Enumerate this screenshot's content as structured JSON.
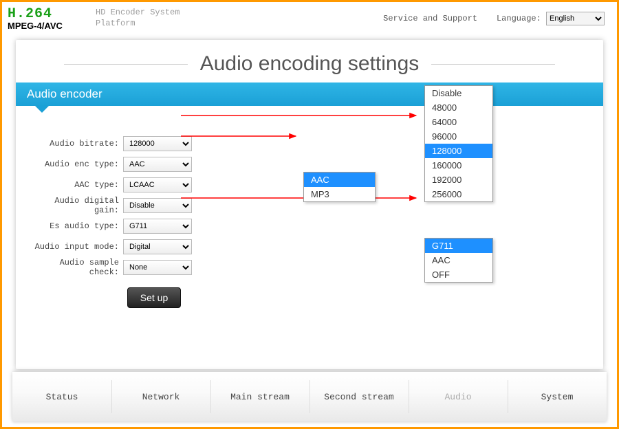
{
  "logo": {
    "line1": "H.264",
    "line2": "MPEG-4/AVC"
  },
  "platform": {
    "line1": "HD Encoder System",
    "line2": "Platform"
  },
  "top": {
    "service": "Service and Support",
    "language_label": "Language:",
    "language_value": "English"
  },
  "page_title": "Audio encoding settings",
  "section_title": "Audio encoder",
  "form": {
    "audio_bitrate": {
      "label": "Audio bitrate:",
      "value": "128000"
    },
    "audio_enc_type": {
      "label": "Audio enc type:",
      "value": "AAC"
    },
    "aac_type": {
      "label": "AAC type:",
      "value": "LCAAC"
    },
    "audio_digital_gain": {
      "label": "Audio digital gain:",
      "value": "Disable"
    },
    "es_audio_type": {
      "label": "Es audio type:",
      "value": "G711"
    },
    "audio_input_mode": {
      "label": "Audio input mode:",
      "value": "Digital"
    },
    "audio_sample_check": {
      "label": "Audio sample check:",
      "value": "None"
    }
  },
  "setup_button": "Set up",
  "dropdowns": {
    "bitrate_options": [
      "Disable",
      "48000",
      "64000",
      "96000",
      "128000",
      "160000",
      "192000",
      "256000"
    ],
    "bitrate_selected": "128000",
    "enc_options": [
      "AAC",
      "MP3"
    ],
    "enc_selected": "AAC",
    "es_options": [
      "G711",
      "AAC",
      "OFF"
    ],
    "es_selected": "G711"
  },
  "tabs": [
    "Status",
    "Network",
    "Main stream",
    "Second stream",
    "Audio",
    "System"
  ],
  "active_tab": "Audio"
}
